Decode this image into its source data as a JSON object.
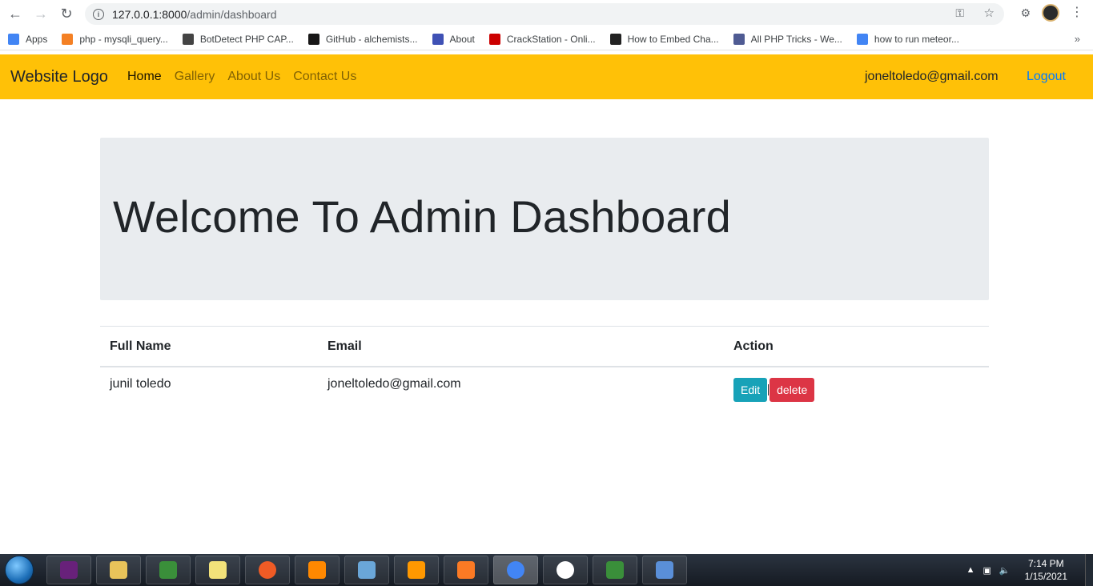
{
  "browser": {
    "url_host": "127.0.0.1:8000",
    "url_path": "/admin/dashboard",
    "bookmarks": [
      {
        "label": "Apps",
        "icon": "apps-grid-icon",
        "color": "#4285f4"
      },
      {
        "label": "php - mysqli_query...",
        "icon": "stackoverflow-icon",
        "color": "#f48024"
      },
      {
        "label": "BotDetect PHP CAP...",
        "icon": "botdetect-icon",
        "color": "#444444"
      },
      {
        "label": "GitHub - alchemists...",
        "icon": "github-icon",
        "color": "#181717"
      },
      {
        "label": "About",
        "icon": "mdb-icon",
        "color": "#3f51b5"
      },
      {
        "label": "CrackStation - Onli...",
        "icon": "crackstation-icon",
        "color": "#cc0000"
      },
      {
        "label": "How to Embed Cha...",
        "icon": "ch-icon",
        "color": "#222222"
      },
      {
        "label": "All PHP Tricks - We...",
        "icon": "php-icon",
        "color": "#4f5b93"
      },
      {
        "label": "how to run meteor...",
        "icon": "google-icon",
        "color": "#4285f4"
      }
    ]
  },
  "navbar": {
    "brand": "Website Logo",
    "links": [
      {
        "label": "Home",
        "active": true
      },
      {
        "label": "Gallery",
        "active": false
      },
      {
        "label": "About Us",
        "active": false
      },
      {
        "label": "Contact Us",
        "active": false
      }
    ],
    "user_email": "joneltoledo@gmail.com",
    "logout": "Logout"
  },
  "jumbotron": {
    "title": "Welcome To Admin Dashboard"
  },
  "table": {
    "headers": [
      "Full Name",
      "Email",
      "Action"
    ],
    "rows": [
      {
        "full_name": "junil toledo",
        "email": "joneltoledo@gmail.com",
        "edit_label": "Edit",
        "delete_label": "delete"
      }
    ]
  },
  "colors": {
    "navbar": "#ffc107",
    "jumbotron": "#e9ecef",
    "edit_button": "#17a2b8",
    "delete_button": "#dc3545",
    "link": "#007bff"
  },
  "taskbar": {
    "time": "7:14 PM",
    "date": "1/15/2021",
    "apps": [
      {
        "name": "visual-studio-icon",
        "color": "#68217a"
      },
      {
        "name": "file-explorer-icon",
        "color": "#e8c35a"
      },
      {
        "name": "git-gui-icon",
        "color": "#3a8f3a"
      },
      {
        "name": "sticky-notes-icon",
        "color": "#f2e27a"
      },
      {
        "name": "postman-icon",
        "color": "#ef5b25"
      },
      {
        "name": "vlc-icon",
        "color": "#ff8800"
      },
      {
        "name": "notepad-icon",
        "color": "#6aa6d8"
      },
      {
        "name": "sublime-text-icon",
        "color": "#ff9800"
      },
      {
        "name": "xampp-icon",
        "color": "#fb7a24"
      },
      {
        "name": "chrome-icon",
        "color": "#4285f4",
        "active": true
      },
      {
        "name": "obs-icon",
        "color": "#ffffff"
      },
      {
        "name": "git-gui-icon-2",
        "color": "#3a8f3a"
      },
      {
        "name": "paint-icon",
        "color": "#5a8fd8"
      }
    ]
  }
}
